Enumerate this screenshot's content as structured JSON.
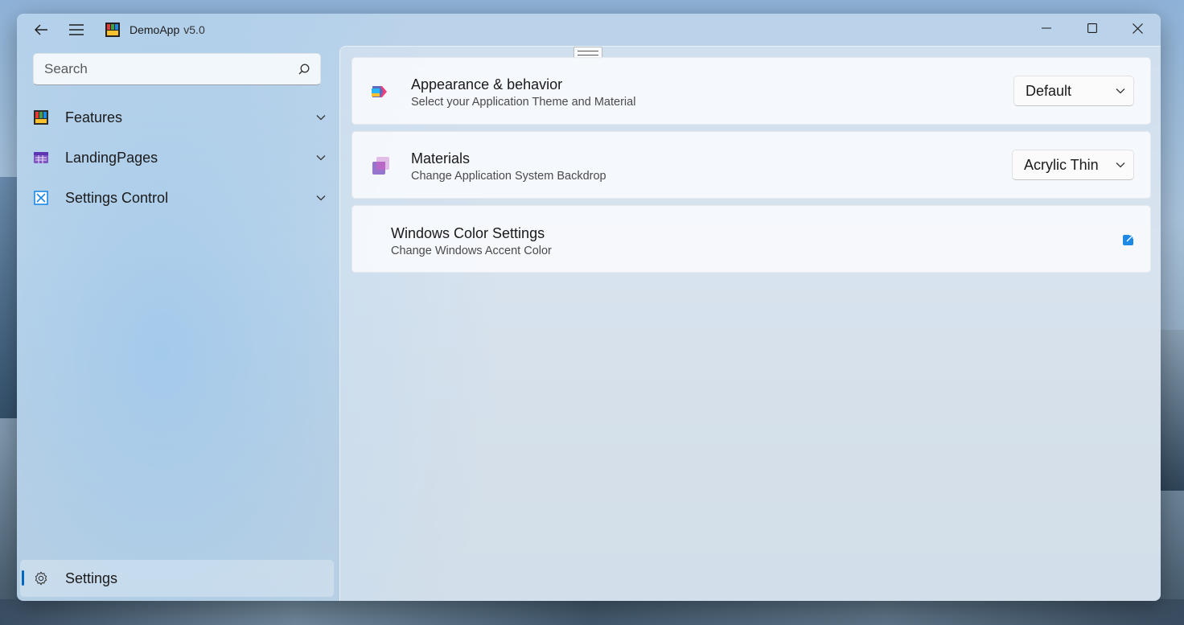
{
  "app": {
    "title": "DemoApp",
    "version": "v5.0"
  },
  "search": {
    "placeholder": "Search"
  },
  "nav": {
    "items": [
      {
        "label": "Features",
        "icon": "features-icon"
      },
      {
        "label": "LandingPages",
        "icon": "landing-pages-icon"
      },
      {
        "label": "Settings Control",
        "icon": "settings-control-icon"
      }
    ],
    "footer": {
      "label": "Settings",
      "icon": "gear-icon"
    }
  },
  "settings": {
    "appearance": {
      "title": "Appearance & behavior",
      "subtitle": "Select your Application Theme and Material",
      "value": "Default"
    },
    "materials": {
      "title": "Materials",
      "subtitle": "Change Application System Backdrop",
      "value": "Acrylic Thin"
    },
    "windows_color": {
      "title": "Windows Color Settings",
      "subtitle": "Change Windows Accent Color"
    }
  },
  "colors": {
    "accent": "#0067c0"
  }
}
